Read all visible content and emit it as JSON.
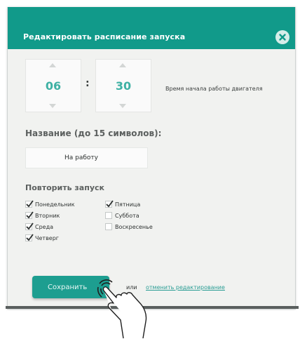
{
  "dialog": {
    "title": "Редактировать расписание запуска",
    "accent_color": "#119a8a"
  },
  "close_button": {
    "icon": "close-icon"
  },
  "time": {
    "hours": "06",
    "minutes": "30",
    "separator": ":",
    "label": "Время начала работы двигателя"
  },
  "name": {
    "heading": "Название (до 15 символов):",
    "value": "На работу",
    "placeholder": ""
  },
  "repeat": {
    "heading": "Повторить запуск",
    "days": [
      {
        "label": "Понедельник",
        "checked": true
      },
      {
        "label": "Вторник",
        "checked": true
      },
      {
        "label": "Среда",
        "checked": true
      },
      {
        "label": "Четверг",
        "checked": true
      },
      {
        "label": "Пятница",
        "checked": true
      },
      {
        "label": "Суббота",
        "checked": false
      },
      {
        "label": "Воскресенье",
        "checked": false
      }
    ]
  },
  "actions": {
    "save_label": "Сохранить",
    "or_text": "или",
    "cancel_label": "отменить редактирование"
  },
  "icons": {
    "touch": "tap-hand-icon",
    "check": "checkmark-icon"
  }
}
